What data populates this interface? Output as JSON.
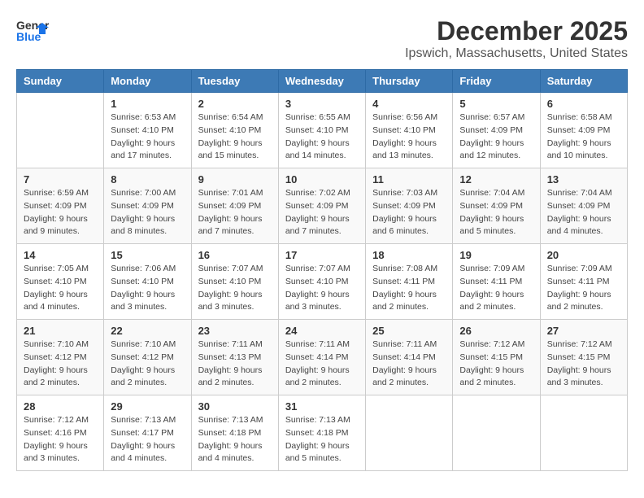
{
  "logo": {
    "general": "General",
    "blue": "Blue"
  },
  "title": "December 2025",
  "subtitle": "Ipswich, Massachusetts, United States",
  "days_of_week": [
    "Sunday",
    "Monday",
    "Tuesday",
    "Wednesday",
    "Thursday",
    "Friday",
    "Saturday"
  ],
  "weeks": [
    [
      {
        "day": "",
        "info": ""
      },
      {
        "day": "1",
        "info": "Sunrise: 6:53 AM\nSunset: 4:10 PM\nDaylight: 9 hours\nand 17 minutes."
      },
      {
        "day": "2",
        "info": "Sunrise: 6:54 AM\nSunset: 4:10 PM\nDaylight: 9 hours\nand 15 minutes."
      },
      {
        "day": "3",
        "info": "Sunrise: 6:55 AM\nSunset: 4:10 PM\nDaylight: 9 hours\nand 14 minutes."
      },
      {
        "day": "4",
        "info": "Sunrise: 6:56 AM\nSunset: 4:10 PM\nDaylight: 9 hours\nand 13 minutes."
      },
      {
        "day": "5",
        "info": "Sunrise: 6:57 AM\nSunset: 4:09 PM\nDaylight: 9 hours\nand 12 minutes."
      },
      {
        "day": "6",
        "info": "Sunrise: 6:58 AM\nSunset: 4:09 PM\nDaylight: 9 hours\nand 10 minutes."
      }
    ],
    [
      {
        "day": "7",
        "info": "Sunrise: 6:59 AM\nSunset: 4:09 PM\nDaylight: 9 hours\nand 9 minutes."
      },
      {
        "day": "8",
        "info": "Sunrise: 7:00 AM\nSunset: 4:09 PM\nDaylight: 9 hours\nand 8 minutes."
      },
      {
        "day": "9",
        "info": "Sunrise: 7:01 AM\nSunset: 4:09 PM\nDaylight: 9 hours\nand 7 minutes."
      },
      {
        "day": "10",
        "info": "Sunrise: 7:02 AM\nSunset: 4:09 PM\nDaylight: 9 hours\nand 7 minutes."
      },
      {
        "day": "11",
        "info": "Sunrise: 7:03 AM\nSunset: 4:09 PM\nDaylight: 9 hours\nand 6 minutes."
      },
      {
        "day": "12",
        "info": "Sunrise: 7:04 AM\nSunset: 4:09 PM\nDaylight: 9 hours\nand 5 minutes."
      },
      {
        "day": "13",
        "info": "Sunrise: 7:04 AM\nSunset: 4:09 PM\nDaylight: 9 hours\nand 4 minutes."
      }
    ],
    [
      {
        "day": "14",
        "info": "Sunrise: 7:05 AM\nSunset: 4:10 PM\nDaylight: 9 hours\nand 4 minutes."
      },
      {
        "day": "15",
        "info": "Sunrise: 7:06 AM\nSunset: 4:10 PM\nDaylight: 9 hours\nand 3 minutes."
      },
      {
        "day": "16",
        "info": "Sunrise: 7:07 AM\nSunset: 4:10 PM\nDaylight: 9 hours\nand 3 minutes."
      },
      {
        "day": "17",
        "info": "Sunrise: 7:07 AM\nSunset: 4:10 PM\nDaylight: 9 hours\nand 3 minutes."
      },
      {
        "day": "18",
        "info": "Sunrise: 7:08 AM\nSunset: 4:11 PM\nDaylight: 9 hours\nand 2 minutes."
      },
      {
        "day": "19",
        "info": "Sunrise: 7:09 AM\nSunset: 4:11 PM\nDaylight: 9 hours\nand 2 minutes."
      },
      {
        "day": "20",
        "info": "Sunrise: 7:09 AM\nSunset: 4:11 PM\nDaylight: 9 hours\nand 2 minutes."
      }
    ],
    [
      {
        "day": "21",
        "info": "Sunrise: 7:10 AM\nSunset: 4:12 PM\nDaylight: 9 hours\nand 2 minutes."
      },
      {
        "day": "22",
        "info": "Sunrise: 7:10 AM\nSunset: 4:12 PM\nDaylight: 9 hours\nand 2 minutes."
      },
      {
        "day": "23",
        "info": "Sunrise: 7:11 AM\nSunset: 4:13 PM\nDaylight: 9 hours\nand 2 minutes."
      },
      {
        "day": "24",
        "info": "Sunrise: 7:11 AM\nSunset: 4:14 PM\nDaylight: 9 hours\nand 2 minutes."
      },
      {
        "day": "25",
        "info": "Sunrise: 7:11 AM\nSunset: 4:14 PM\nDaylight: 9 hours\nand 2 minutes."
      },
      {
        "day": "26",
        "info": "Sunrise: 7:12 AM\nSunset: 4:15 PM\nDaylight: 9 hours\nand 2 minutes."
      },
      {
        "day": "27",
        "info": "Sunrise: 7:12 AM\nSunset: 4:15 PM\nDaylight: 9 hours\nand 3 minutes."
      }
    ],
    [
      {
        "day": "28",
        "info": "Sunrise: 7:12 AM\nSunset: 4:16 PM\nDaylight: 9 hours\nand 3 minutes."
      },
      {
        "day": "29",
        "info": "Sunrise: 7:13 AM\nSunset: 4:17 PM\nDaylight: 9 hours\nand 4 minutes."
      },
      {
        "day": "30",
        "info": "Sunrise: 7:13 AM\nSunset: 4:18 PM\nDaylight: 9 hours\nand 4 minutes."
      },
      {
        "day": "31",
        "info": "Sunrise: 7:13 AM\nSunset: 4:18 PM\nDaylight: 9 hours\nand 5 minutes."
      },
      {
        "day": "",
        "info": ""
      },
      {
        "day": "",
        "info": ""
      },
      {
        "day": "",
        "info": ""
      }
    ]
  ]
}
